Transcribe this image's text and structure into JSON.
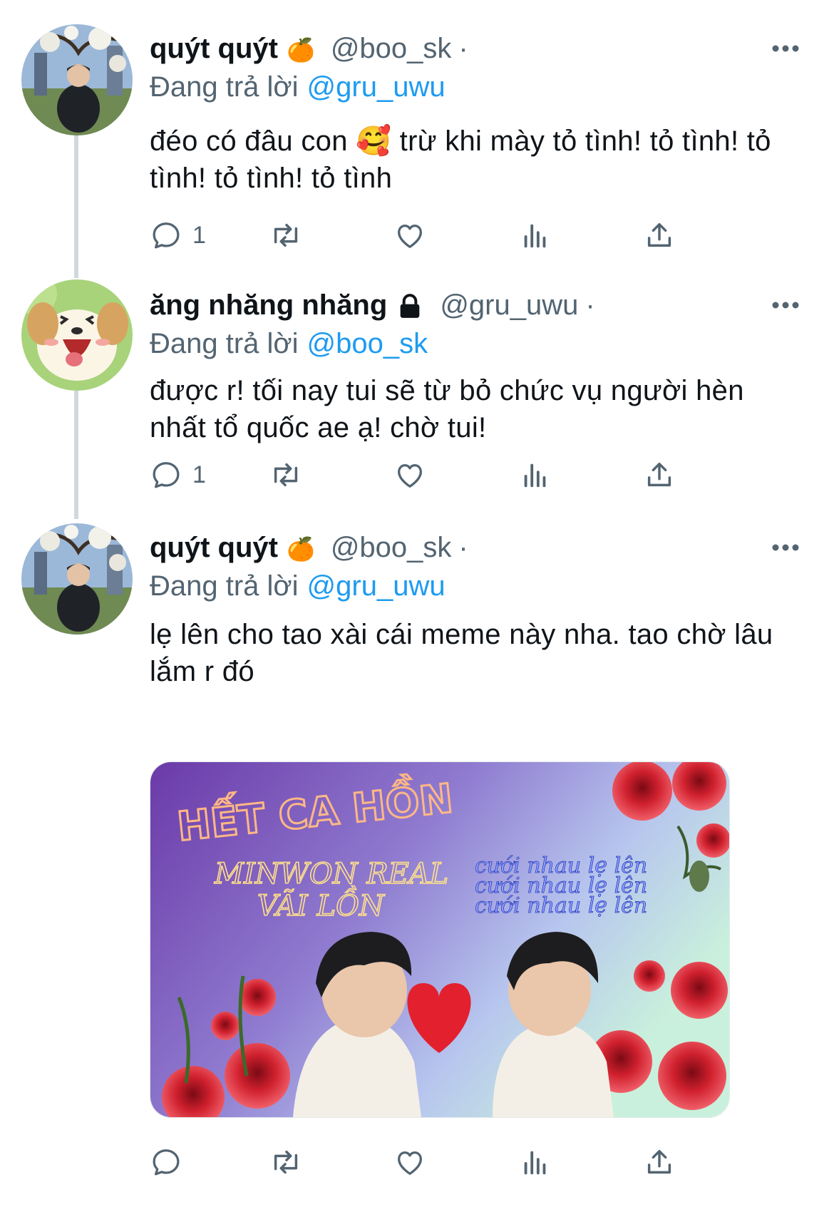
{
  "tweets": [
    {
      "display_name": "quýt quýt",
      "name_emoji": "🍊",
      "handle": "@boo_sk",
      "dot": "·",
      "reply_label": "Đang trả lời",
      "reply_mention": "@gru_uwu",
      "text": "đéo có đâu con 🥰  trừ khi mày tỏ tình! tỏ tình! tỏ tình! tỏ tình! tỏ tình",
      "reply_count": "1"
    },
    {
      "display_name": "ăng nhăng nhăng",
      "name_emoji": "lock-icon",
      "handle": "@gru_uwu",
      "dot": "·",
      "reply_label": "Đang trả lời",
      "reply_mention": "@boo_sk",
      "text": "được r! tối nay tui sẽ từ bỏ chức vụ người hèn nhất tổ quốc ae ạ! chờ tui!",
      "reply_count": "1"
    },
    {
      "display_name": "quýt quýt",
      "name_emoji": "🍊",
      "handle": "@boo_sk",
      "dot": "·",
      "reply_label": "Đang trả lời",
      "reply_mention": "@gru_uwu",
      "text": "lẹ lên cho tao xài cái meme này nha. tao chờ lâu lắm r đó",
      "reply_count": ""
    }
  ],
  "meme": {
    "title": "HẾT CA HỒN",
    "line1": "MINWON REAL",
    "line2": "VÃI LỒN",
    "repeat1": "cưới nhau lẹ lên",
    "repeat2": "cưới nhau lẹ lên",
    "repeat3": "cưới nhau lẹ lên"
  },
  "icons": [
    "reply-icon",
    "retweet-icon",
    "like-icon",
    "analytics-icon",
    "share-icon",
    "more-icon"
  ],
  "colors": {
    "accent": "#1d9bf0",
    "secondary_text": "#536471",
    "thread_line": "#cfd9de"
  }
}
